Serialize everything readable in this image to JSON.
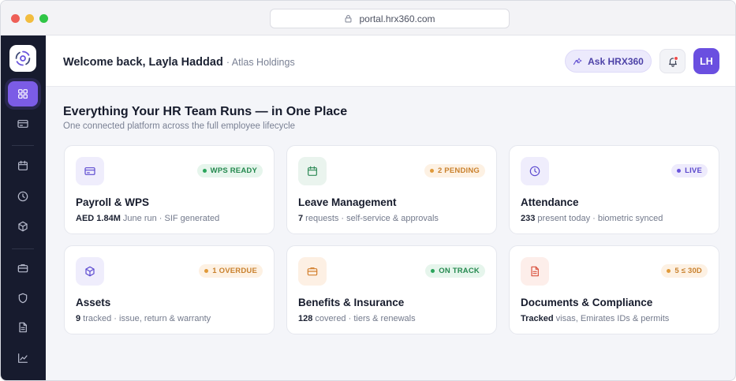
{
  "browser": {
    "url": "portal.hrx360.com"
  },
  "header": {
    "welcome": "Welcome back, Layla Haddad",
    "org": "· Atlas Holdings",
    "ask_label": "Ask HRX360",
    "avatar_initials": "LH"
  },
  "main": {
    "headline": "Everything Your HR Team Runs — in One Place",
    "subline": "One connected platform across the full employee lifecycle",
    "cards": [
      {
        "title": "Payroll & WPS",
        "badge": "WPS READY",
        "meta_value": "AED 1.84M",
        "meta_text": " June run · SIF generated",
        "icon": "credit-card-icon",
        "tone": "purple",
        "badge_tone": "green"
      },
      {
        "title": "Leave Management",
        "badge": "2 PENDING",
        "meta_value": "7",
        "meta_text": " requests · self-service & approvals",
        "icon": "calendar-icon",
        "tone": "green",
        "badge_tone": "orange"
      },
      {
        "title": "Attendance",
        "badge": "LIVE",
        "meta_value": "233",
        "meta_text": " present today · biometric synced",
        "icon": "clock-icon",
        "tone": "purple",
        "badge_tone": "purple"
      },
      {
        "title": "Assets",
        "badge": "1 OVERDUE",
        "meta_value": "9",
        "meta_text": " tracked · issue, return & warranty",
        "icon": "cube-icon",
        "tone": "purple",
        "badge_tone": "orange"
      },
      {
        "title": "Benefits & Insurance",
        "badge": "ON TRACK",
        "meta_value": "128",
        "meta_text": " covered · tiers & renewals",
        "icon": "briefcase-icon",
        "tone": "orange",
        "badge_tone": "green"
      },
      {
        "title": "Documents & Compliance",
        "badge": "5 ≤ 30D",
        "meta_value": "Tracked",
        "meta_text": " visas, Emirates IDs & permits",
        "icon": "document-icon",
        "tone": "red",
        "badge_tone": "orange"
      }
    ]
  },
  "sidebar": {
    "items": [
      {
        "icon": "dashboard-grid-icon",
        "active": true
      },
      {
        "icon": "credit-card-icon"
      },
      {
        "icon": "calendar-icon"
      },
      {
        "icon": "clock-icon"
      },
      {
        "icon": "cube-icon"
      },
      {
        "icon": "briefcase-icon"
      },
      {
        "icon": "shield-icon"
      },
      {
        "icon": "document-icon"
      },
      {
        "icon": "chart-icon"
      }
    ]
  },
  "colors": {
    "accent": "#7b5ce6",
    "sidebar": "#171b2e",
    "green": "#25894f",
    "orange": "#c9812d",
    "red": "#d9533f"
  }
}
